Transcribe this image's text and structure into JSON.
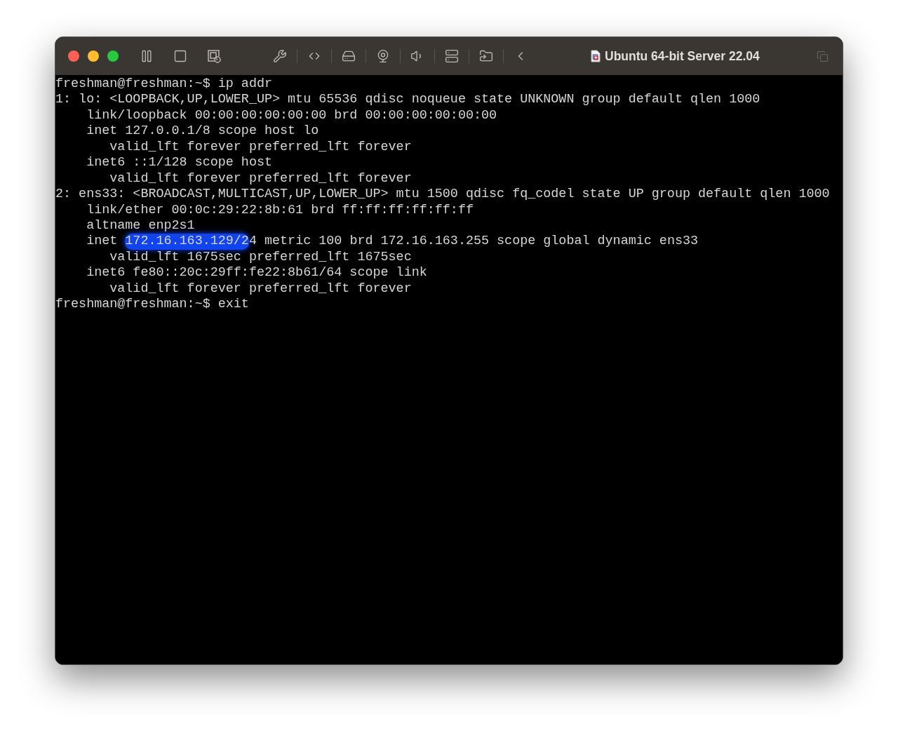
{
  "window": {
    "title": "Ubuntu 64-bit Server 22.04"
  },
  "terminal": {
    "lines": [
      {
        "parts": [
          {
            "text": "freshman@freshman:~$ ip addr",
            "highlighted": false
          }
        ]
      },
      {
        "parts": [
          {
            "text": "1: lo: <LOOPBACK,UP,LOWER_UP> mtu 65536 qdisc noqueue state UNKNOWN group default qlen 1000",
            "highlighted": false
          }
        ]
      },
      {
        "parts": [
          {
            "text": "    link/loopback 00:00:00:00:00:00 brd 00:00:00:00:00:00",
            "highlighted": false
          }
        ]
      },
      {
        "parts": [
          {
            "text": "    inet 127.0.0.1/8 scope host lo",
            "highlighted": false
          }
        ]
      },
      {
        "parts": [
          {
            "text": "       valid_lft forever preferred_lft forever",
            "highlighted": false
          }
        ]
      },
      {
        "parts": [
          {
            "text": "    inet6 ::1/128 scope host",
            "highlighted": false
          }
        ]
      },
      {
        "parts": [
          {
            "text": "       valid_lft forever preferred_lft forever",
            "highlighted": false
          }
        ]
      },
      {
        "parts": [
          {
            "text": "2: ens33: <BROADCAST,MULTICAST,UP,LOWER_UP> mtu 1500 qdisc fq_codel state UP group default qlen 1000",
            "highlighted": false
          }
        ]
      },
      {
        "parts": [
          {
            "text": "    link/ether 00:0c:29:22:8b:61 brd ff:ff:ff:ff:ff:ff",
            "highlighted": false
          }
        ]
      },
      {
        "parts": [
          {
            "text": "    altname enp2s1",
            "highlighted": false
          }
        ]
      },
      {
        "parts": [
          {
            "text": "    inet ",
            "highlighted": false
          },
          {
            "text": "172.16.163.129/2",
            "highlighted": true
          },
          {
            "text": "4 metric 100 brd 172.16.163.255 scope global dynamic ens33",
            "highlighted": false
          }
        ]
      },
      {
        "parts": [
          {
            "text": "       valid_lft 1675sec preferred_lft 1675sec",
            "highlighted": false
          }
        ]
      },
      {
        "parts": [
          {
            "text": "    inet6 fe80::20c:29ff:fe22:8b61/64 scope link",
            "highlighted": false
          }
        ]
      },
      {
        "parts": [
          {
            "text": "       valid_lft forever preferred_lft forever",
            "highlighted": false
          }
        ]
      },
      {
        "parts": [
          {
            "text": "freshman@freshman:~$ exit",
            "highlighted": false
          }
        ]
      }
    ]
  }
}
